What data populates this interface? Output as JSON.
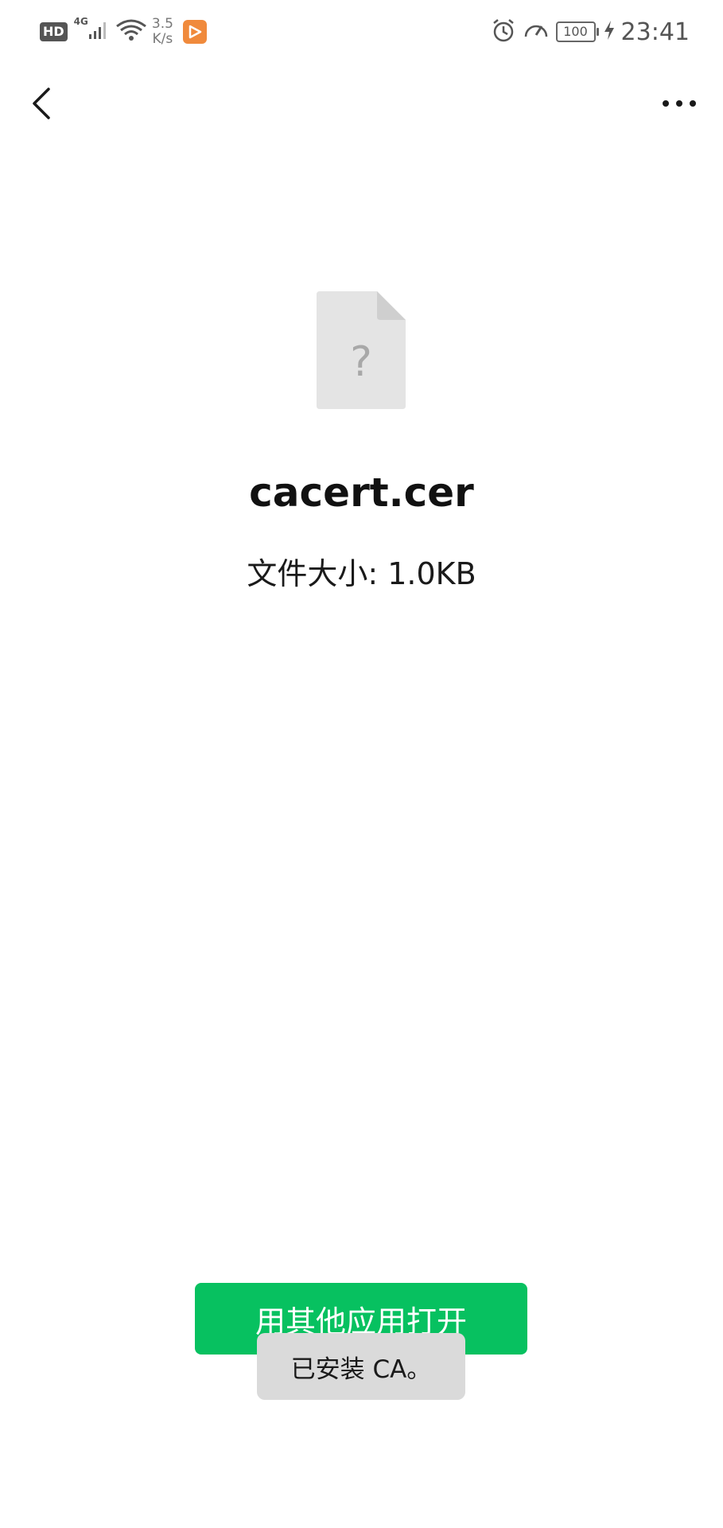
{
  "status_bar": {
    "hd_label": "HD",
    "network_label": "4G",
    "speed_value": "3.5",
    "speed_unit": "K/s",
    "battery_level": "100",
    "time": "23:41",
    "icons": [
      "signal-icon",
      "wifi-icon",
      "app-badge-icon",
      "alarm-icon",
      "speed-meter-icon",
      "battery-icon",
      "charging-icon"
    ]
  },
  "navbar": {
    "icons": [
      "back-icon",
      "more-icon"
    ]
  },
  "file": {
    "icon": "unknown-file-icon",
    "icon_glyph": "?",
    "name": "cacert.cer",
    "size_text": "文件大小: 1.0KB"
  },
  "actions": {
    "open_with_other_app_label": "用其他应用打开"
  },
  "toast": {
    "message": "已安装 CA。"
  },
  "colors": {
    "primary_button": "#07c160",
    "toast_background": "#dadada",
    "file_icon": "#e4e4e4"
  }
}
